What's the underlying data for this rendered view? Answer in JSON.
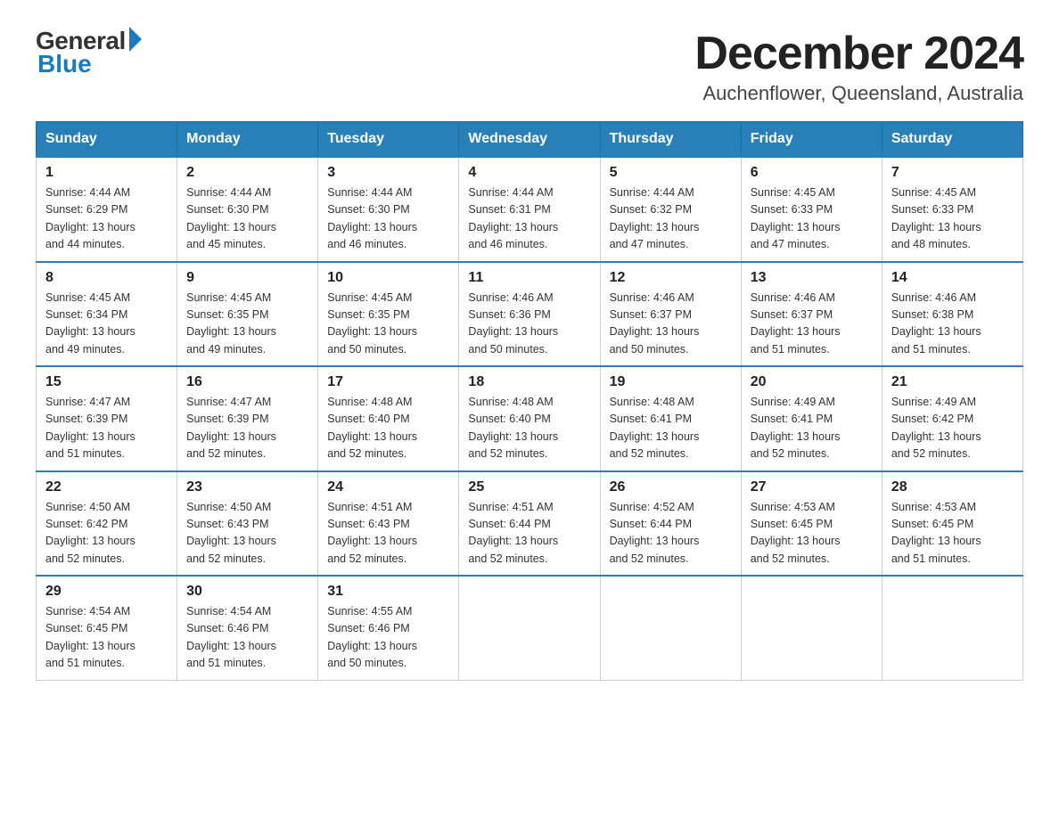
{
  "logo": {
    "general": "General",
    "blue": "Blue"
  },
  "title": "December 2024",
  "subtitle": "Auchenflower, Queensland, Australia",
  "days_of_week": [
    "Sunday",
    "Monday",
    "Tuesday",
    "Wednesday",
    "Thursday",
    "Friday",
    "Saturday"
  ],
  "weeks": [
    [
      {
        "day": "1",
        "sunrise": "4:44 AM",
        "sunset": "6:29 PM",
        "daylight": "13 hours and 44 minutes."
      },
      {
        "day": "2",
        "sunrise": "4:44 AM",
        "sunset": "6:30 PM",
        "daylight": "13 hours and 45 minutes."
      },
      {
        "day": "3",
        "sunrise": "4:44 AM",
        "sunset": "6:30 PM",
        "daylight": "13 hours and 46 minutes."
      },
      {
        "day": "4",
        "sunrise": "4:44 AM",
        "sunset": "6:31 PM",
        "daylight": "13 hours and 46 minutes."
      },
      {
        "day": "5",
        "sunrise": "4:44 AM",
        "sunset": "6:32 PM",
        "daylight": "13 hours and 47 minutes."
      },
      {
        "day": "6",
        "sunrise": "4:45 AM",
        "sunset": "6:33 PM",
        "daylight": "13 hours and 47 minutes."
      },
      {
        "day": "7",
        "sunrise": "4:45 AM",
        "sunset": "6:33 PM",
        "daylight": "13 hours and 48 minutes."
      }
    ],
    [
      {
        "day": "8",
        "sunrise": "4:45 AM",
        "sunset": "6:34 PM",
        "daylight": "13 hours and 49 minutes."
      },
      {
        "day": "9",
        "sunrise": "4:45 AM",
        "sunset": "6:35 PM",
        "daylight": "13 hours and 49 minutes."
      },
      {
        "day": "10",
        "sunrise": "4:45 AM",
        "sunset": "6:35 PM",
        "daylight": "13 hours and 50 minutes."
      },
      {
        "day": "11",
        "sunrise": "4:46 AM",
        "sunset": "6:36 PM",
        "daylight": "13 hours and 50 minutes."
      },
      {
        "day": "12",
        "sunrise": "4:46 AM",
        "sunset": "6:37 PM",
        "daylight": "13 hours and 50 minutes."
      },
      {
        "day": "13",
        "sunrise": "4:46 AM",
        "sunset": "6:37 PM",
        "daylight": "13 hours and 51 minutes."
      },
      {
        "day": "14",
        "sunrise": "4:46 AM",
        "sunset": "6:38 PM",
        "daylight": "13 hours and 51 minutes."
      }
    ],
    [
      {
        "day": "15",
        "sunrise": "4:47 AM",
        "sunset": "6:39 PM",
        "daylight": "13 hours and 51 minutes."
      },
      {
        "day": "16",
        "sunrise": "4:47 AM",
        "sunset": "6:39 PM",
        "daylight": "13 hours and 52 minutes."
      },
      {
        "day": "17",
        "sunrise": "4:48 AM",
        "sunset": "6:40 PM",
        "daylight": "13 hours and 52 minutes."
      },
      {
        "day": "18",
        "sunrise": "4:48 AM",
        "sunset": "6:40 PM",
        "daylight": "13 hours and 52 minutes."
      },
      {
        "day": "19",
        "sunrise": "4:48 AM",
        "sunset": "6:41 PM",
        "daylight": "13 hours and 52 minutes."
      },
      {
        "day": "20",
        "sunrise": "4:49 AM",
        "sunset": "6:41 PM",
        "daylight": "13 hours and 52 minutes."
      },
      {
        "day": "21",
        "sunrise": "4:49 AM",
        "sunset": "6:42 PM",
        "daylight": "13 hours and 52 minutes."
      }
    ],
    [
      {
        "day": "22",
        "sunrise": "4:50 AM",
        "sunset": "6:42 PM",
        "daylight": "13 hours and 52 minutes."
      },
      {
        "day": "23",
        "sunrise": "4:50 AM",
        "sunset": "6:43 PM",
        "daylight": "13 hours and 52 minutes."
      },
      {
        "day": "24",
        "sunrise": "4:51 AM",
        "sunset": "6:43 PM",
        "daylight": "13 hours and 52 minutes."
      },
      {
        "day": "25",
        "sunrise": "4:51 AM",
        "sunset": "6:44 PM",
        "daylight": "13 hours and 52 minutes."
      },
      {
        "day": "26",
        "sunrise": "4:52 AM",
        "sunset": "6:44 PM",
        "daylight": "13 hours and 52 minutes."
      },
      {
        "day": "27",
        "sunrise": "4:53 AM",
        "sunset": "6:45 PM",
        "daylight": "13 hours and 52 minutes."
      },
      {
        "day": "28",
        "sunrise": "4:53 AM",
        "sunset": "6:45 PM",
        "daylight": "13 hours and 51 minutes."
      }
    ],
    [
      {
        "day": "29",
        "sunrise": "4:54 AM",
        "sunset": "6:45 PM",
        "daylight": "13 hours and 51 minutes."
      },
      {
        "day": "30",
        "sunrise": "4:54 AM",
        "sunset": "6:46 PM",
        "daylight": "13 hours and 51 minutes."
      },
      {
        "day": "31",
        "sunrise": "4:55 AM",
        "sunset": "6:46 PM",
        "daylight": "13 hours and 50 minutes."
      },
      null,
      null,
      null,
      null
    ]
  ]
}
